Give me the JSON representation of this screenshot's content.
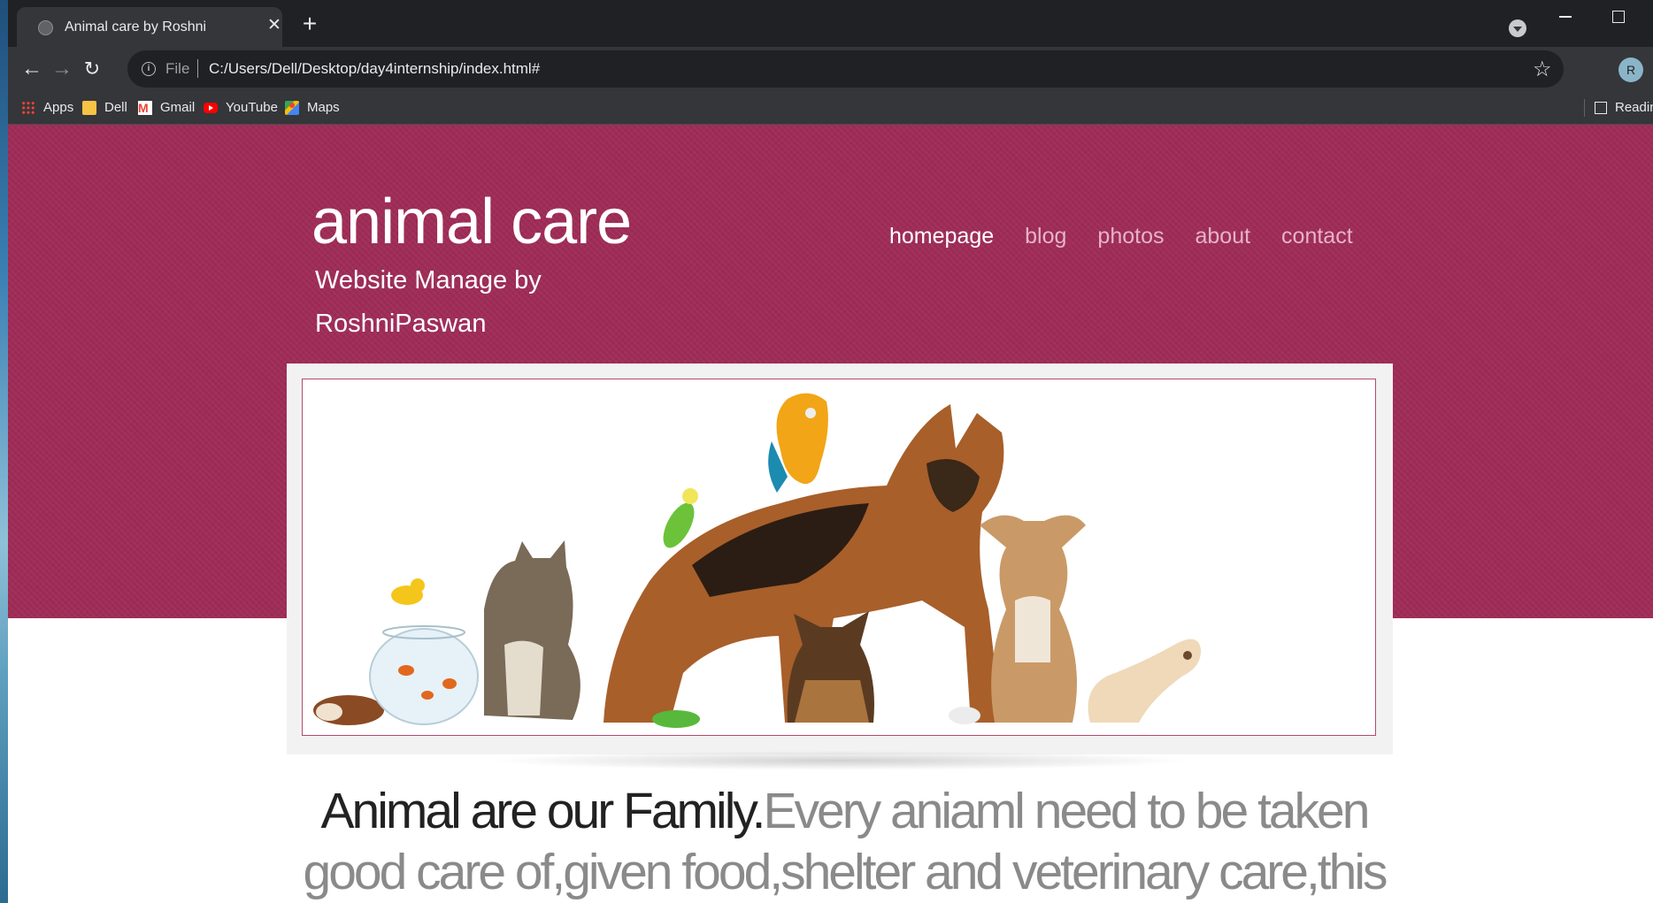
{
  "browser": {
    "tab_title": "Animal care by Roshni",
    "new_tab_symbol": "+",
    "close_symbol": "✕",
    "address": {
      "scheme_label": "File",
      "url": "C:/Users/Dell/Desktop/day4internship/index.html#"
    },
    "profile_initial": "R",
    "bookmarks": [
      {
        "label": "Apps",
        "icon": "apps-grid-icon"
      },
      {
        "label": "Dell",
        "icon": "folder-icon"
      },
      {
        "label": "Gmail",
        "icon": "gmail-icon"
      },
      {
        "label": "YouTube",
        "icon": "youtube-icon"
      },
      {
        "label": "Maps",
        "icon": "maps-icon"
      }
    ],
    "reading_list_label": "Reading",
    "icons": [
      "back-arrow-icon",
      "forward-arrow-icon",
      "reload-icon",
      "info-icon",
      "star-icon",
      "tab-search-icon",
      "minimize-icon",
      "maximize-icon"
    ]
  },
  "site": {
    "logo": "animal care",
    "tagline": "Website Manage by RoshniPaswan",
    "nav": [
      {
        "label": "homepage",
        "active": true
      },
      {
        "label": "blog",
        "active": false
      },
      {
        "label": "photos",
        "active": false
      },
      {
        "label": "about",
        "active": false
      },
      {
        "label": "contact",
        "active": false
      }
    ],
    "hero_image": "group of pets: guinea pig, goldfish bowl, canary, cat, budgie, macaw, german shepherd, puppy, frog, mouse, terrier, ferret",
    "headline_lead": "Animal are our Family.",
    "headline_rest": "Every aniaml need to be taken good care of,given food,shelter and veterinary care,this"
  },
  "colors": {
    "brand_band": "#9f2c56",
    "nav_active": "#ffffff",
    "nav_inactive": "#e7b3c5",
    "headline_lead": "#222222",
    "headline_rest": "#8a8a8a"
  }
}
